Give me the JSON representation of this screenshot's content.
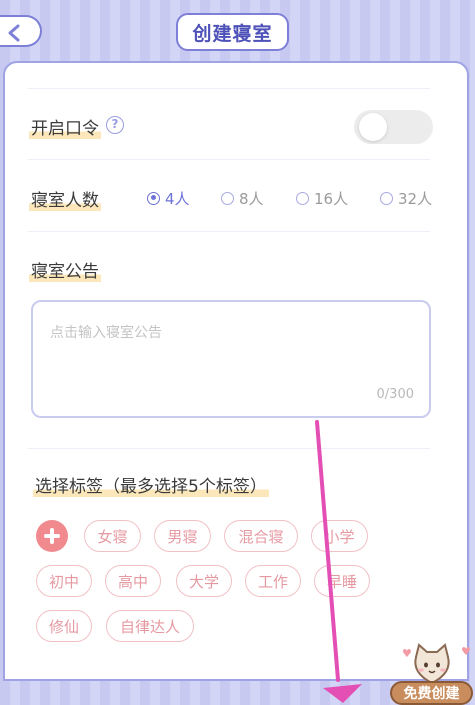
{
  "header": {
    "title": "创建寝室",
    "back_icon": "back-arrow-icon"
  },
  "password": {
    "label": "开启口令",
    "help_icon": "?",
    "enabled": false
  },
  "members": {
    "label": "寝室人数",
    "options": [
      {
        "label": "4人",
        "selected": true
      },
      {
        "label": "8人",
        "selected": false
      },
      {
        "label": "16人",
        "selected": false
      },
      {
        "label": "32人",
        "selected": false
      }
    ]
  },
  "announcement": {
    "label": "寝室公告",
    "placeholder": "点击输入寝室公告",
    "count": "0/300"
  },
  "tags": {
    "label": "选择标签（最多选择5个标签）",
    "items": [
      "女寝",
      "男寝",
      "混合寝",
      "小学",
      "初中",
      "高中",
      "大学",
      "工作",
      "早睡",
      "修仙",
      "自律达人"
    ]
  },
  "free_create": {
    "label": "免费创建"
  },
  "colors": {
    "accent": "#6f72d6",
    "tag_pink": "#e59aa2",
    "plus_pink": "#f08a8f",
    "arrow": "#e34fb4"
  }
}
